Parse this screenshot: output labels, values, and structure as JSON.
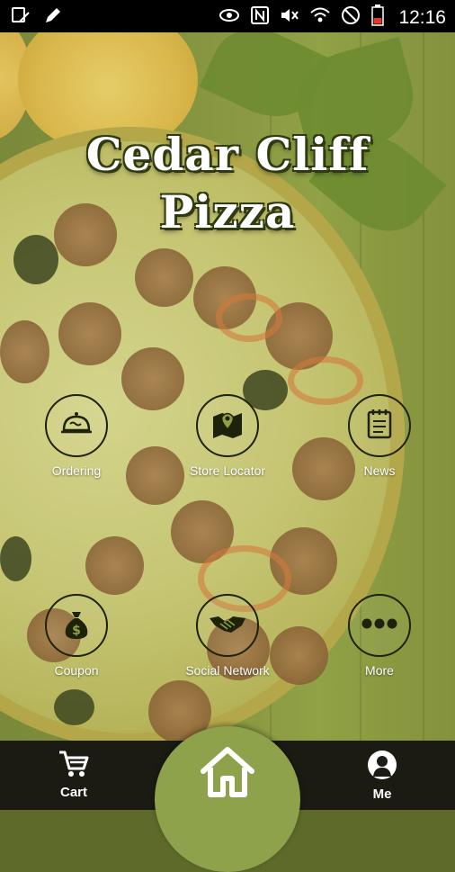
{
  "status_bar": {
    "time": "12:16",
    "icons": [
      "signal-sim-icon",
      "pen-icon",
      "eye-icon",
      "nfc-icon",
      "mute-icon",
      "wifi-icon",
      "blocked-icon",
      "battery-icon"
    ]
  },
  "app": {
    "title_line1": "Cedar Cliff",
    "title_line2": "Pizza"
  },
  "menu": {
    "items": [
      {
        "label": "Ordering",
        "icon": "cloche-icon"
      },
      {
        "label": "Store Locator",
        "icon": "map-pin-icon"
      },
      {
        "label": "News",
        "icon": "notepad-icon"
      },
      {
        "label": "Coupon",
        "icon": "money-bag-icon"
      },
      {
        "label": "Social Network",
        "icon": "handshake-icon"
      },
      {
        "label": "More",
        "icon": "more-dots-icon"
      }
    ]
  },
  "bottom_bar": {
    "cart_label": "Cart",
    "home_icon": "home-icon",
    "me_label": "Me"
  },
  "colors": {
    "bottom_bar": "#1b1b14",
    "home_button": "#8da24a",
    "icon_stroke": "#1d2208",
    "title_text": "#ffffff"
  }
}
